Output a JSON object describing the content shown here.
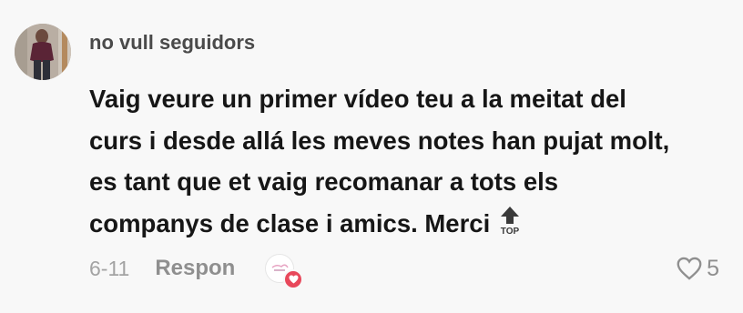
{
  "comment": {
    "username": "no vull seguidors",
    "text_lines": [
      "Vaig veure un primer vídeo teu a la meitat del",
      "curs i desde allá les meves notes han pujat molt,",
      "es tant que et vaig recomanar a tots els",
      "companys de clase i amics. Merci"
    ],
    "top_emoji_label": "TOP",
    "date": "6-11",
    "reply_label": "Respon",
    "like_count": "5"
  },
  "icons": {
    "avatar": "user-photo-avatar",
    "top_emoji": "top-arrow-emoji-icon",
    "creator_like": "creator-liked-heart-icon",
    "like": "heart-outline-icon"
  },
  "colors": {
    "background": "#f8f8f8",
    "text": "#161616",
    "username": "#4a4a4a",
    "meta": "#a3a3a3",
    "heart_badge": "#e8485b"
  }
}
